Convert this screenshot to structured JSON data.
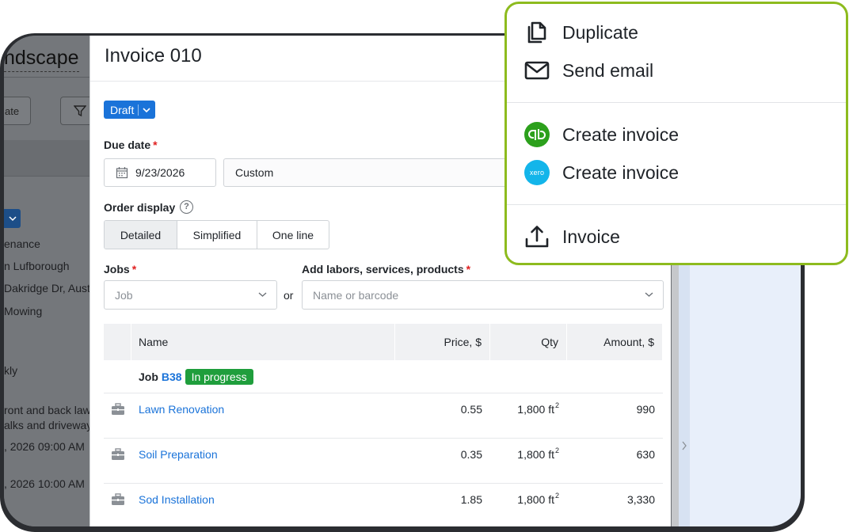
{
  "background": {
    "title": "ndscape",
    "button_left_label": "ate",
    "rows": [
      "enance",
      "n Lufborough",
      "Dakridge Dr, Aust",
      "Mowing",
      "kly",
      "ront and back law",
      "alks and driveway",
      ", 2026 09:00 AM",
      ", 2026 10:00 AM"
    ]
  },
  "invoice": {
    "title": "Invoice 010",
    "status": "Draft",
    "due_date_label": "Due date",
    "due_date_value": "9/23/2026",
    "due_term": "Custom",
    "order_display_label": "Order display",
    "order_display_options": [
      "Detailed",
      "Simplified",
      "One line"
    ],
    "order_display_selected": "Detailed",
    "jobs_label": "Jobs",
    "jobs_placeholder": "Job",
    "or_text": "or",
    "add_label": "Add labors, services, products",
    "add_placeholder": "Name or barcode",
    "required_mark": "*"
  },
  "table": {
    "headers": [
      "Name",
      "Price, $",
      "Qty",
      "Amount, $"
    ],
    "job_group": {
      "prefix": "Job",
      "job_id": "B38",
      "status": "In progress"
    },
    "rows": [
      {
        "name": "Lawn Renovation",
        "price": "0.55",
        "qty": "1,800 ft",
        "unit_sup": "2",
        "amount": "990"
      },
      {
        "name": "Soil Preparation",
        "price": "0.35",
        "qty": "1,800 ft",
        "unit_sup": "2",
        "amount": "630"
      },
      {
        "name": "Sod Installation",
        "price": "1.85",
        "qty": "1,800 ft",
        "unit_sup": "2",
        "amount": "3,330"
      }
    ]
  },
  "menu": {
    "duplicate": "Duplicate",
    "send_email": "Send email",
    "create_invoice_qb": "Create invoice",
    "create_invoice_xero": "Create invoice",
    "qb_logo_text": "qb",
    "xero_logo_text": "xero",
    "export_invoice": "Invoice"
  },
  "colors": {
    "accent_blue": "#1a73d9",
    "status_green": "#1f9e3c",
    "menu_border": "#8dbb1e",
    "quickbooks_green": "#2ca01c",
    "xero_blue": "#13b5ea",
    "required_red": "#e02020"
  },
  "icons": {
    "duplicate": "duplicate-icon",
    "send_email": "mail-icon",
    "quickbooks": "quickbooks-icon",
    "xero": "xero-icon",
    "export": "upload-icon",
    "calendar": "calendar-icon",
    "help": "help-icon",
    "chevron": "chevron-down-icon",
    "item": "toolbox-icon"
  }
}
